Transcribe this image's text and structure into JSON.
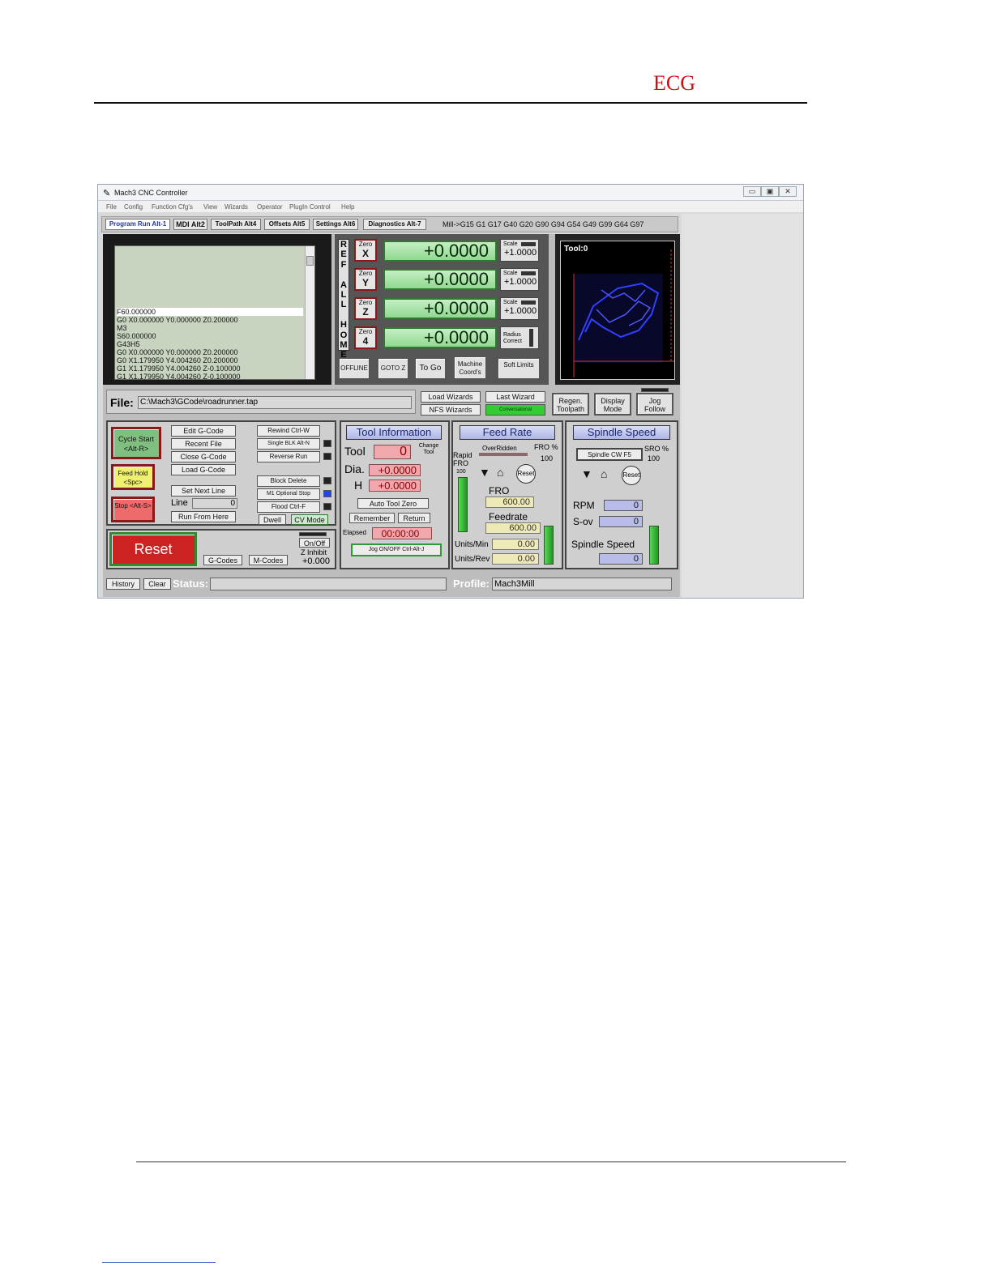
{
  "doc": {
    "header": "ECG"
  },
  "window": {
    "title": "Mach3 CNC Controller",
    "controls": {
      "minimize": "▭",
      "maximize": "▣",
      "close": "✕"
    }
  },
  "menu": [
    "File",
    "Config",
    "Function Cfg's",
    "View",
    "Wizards",
    "Operator",
    "PlugIn Control",
    "Help"
  ],
  "tabs": [
    "Program Run Alt-1",
    "MDI Alt2",
    "ToolPath Alt4",
    "Offsets Alt5",
    "Settings Alt6",
    "Diagnostics Alt-7"
  ],
  "active_gcodes": "Mill->G15  G1 G17 G40 G20 G90 G94 G54 G49 G99 G64 G97",
  "gcode_lines": [
    "F60.000000",
    "G0 X0.000000 Y0.000000 Z0.200000",
    "M3",
    "S60.000000",
    "G43H5",
    "G0 X0.000000 Y0.000000 Z0.200000",
    "G0 X1.179950 Y4.004260 Z0.200000",
    "G1 X1.179950 Y4.004260 Z-0.100000",
    "G1 X1.179950 Y4.004260 Z-0.100000"
  ],
  "ref_all_home": "REF ALL HOME",
  "axes": [
    {
      "zero_label": "Zero",
      "axis": "X",
      "value": "+0.0000",
      "aux_label": "Scale",
      "aux_value": "+1.0000"
    },
    {
      "zero_label": "Zero",
      "axis": "Y",
      "value": "+0.0000",
      "aux_label": "Scale",
      "aux_value": "+1.0000"
    },
    {
      "zero_label": "Zero",
      "axis": "Z",
      "value": "+0.0000",
      "aux_label": "Scale",
      "aux_value": "+1.0000"
    },
    {
      "zero_label": "Zero",
      "axis": "4",
      "value": "+0.0000",
      "aux_label": "Radius Correct",
      "aux_value": ""
    }
  ],
  "dro_buttons": {
    "offline": "OFFLINE",
    "goto_z": "GOTO Z",
    "to_go": "To Go",
    "machine_coords": "Machine Coord's",
    "soft_limits": "Soft Limits"
  },
  "toolpath": {
    "label": "Tool:0"
  },
  "file": {
    "label": "File:",
    "path": "C:\\Mach3\\GCode\\roadrunner.tap"
  },
  "wizards": {
    "load": "Load Wizards",
    "last": "Last Wizard",
    "nfs": "NFS Wizards",
    "conv": "Conversational"
  },
  "view_buttons": {
    "regen": "Regen. Toolpath",
    "display": "Display Mode",
    "jog": "Jog Follow"
  },
  "run": {
    "cycle_start": "Cycle Start <Alt-R>",
    "feed_hold": "Feed Hold <Spc>",
    "stop": "Stop <Alt-S>",
    "edit": "Edit G-Code",
    "recent": "Recent File",
    "close": "Close G-Code",
    "load": "Load G-Code",
    "set_next": "Set Next Line",
    "line_label": "Line",
    "line_value": "0",
    "run_from_here": "Run From Here",
    "rewind": "Rewind Ctrl-W",
    "single": "Single BLK Alt-N",
    "reverse": "Reverse Run",
    "block_delete": "Block Delete",
    "m1": "M1 Optional Stop",
    "flood": "Flood Ctrl-F",
    "dwell": "Dwell",
    "cv_mode": "CV Mode",
    "reset": "Reset",
    "onoff": "On/Off",
    "z_inhibit": "Z Inhibit",
    "z_inhibit_value": "+0.000",
    "gcodes_btn": "G-Codes",
    "mcodes_btn": "M-Codes"
  },
  "tool_info": {
    "title": "Tool Information",
    "tool_label": "Tool",
    "tool_value": "0",
    "change_label": "Change Tool",
    "dia_label": "Dia.",
    "dia_value": "+0.0000",
    "h_label": "H",
    "h_value": "+0.0000",
    "auto_zero": "Auto Tool Zero",
    "remember": "Remember",
    "return": "Return",
    "elapsed_label": "Elapsed",
    "elapsed_value": "00:00:00",
    "jog_toggle": "Jog ON/OFF Ctrl-Alt-J"
  },
  "feed": {
    "title": "Feed Rate",
    "overridden": "OverRidden",
    "fro_pct_label": "FRO %",
    "fro_pct": "100",
    "rapid_label": "Rapid FRO",
    "rapid_value": "100",
    "reset": "Reset",
    "fro_label": "FRO",
    "fro_value": "600.00",
    "feedrate_label": "Feedrate",
    "feedrate_value": "600.00",
    "units_min_label": "Units/Min",
    "units_min_value": "0.00",
    "units_rev_label": "Units/Rev",
    "units_rev_value": "0.00"
  },
  "spindle": {
    "title": "Spindle Speed",
    "cw_btn": "Spindle CW F5",
    "sro_label": "SRO %",
    "sro_value": "100",
    "reset": "Reset",
    "rpm_label": "RPM",
    "rpm_value": "0",
    "sov_label": "S-ov",
    "sov_value": "0",
    "speed_label": "Spindle Speed",
    "speed_value": "0"
  },
  "status": {
    "history": "History",
    "clear": "Clear",
    "status_label": "Status:",
    "status_value": "",
    "profile_label": "Profile:",
    "profile_value": "Mach3Mill"
  }
}
